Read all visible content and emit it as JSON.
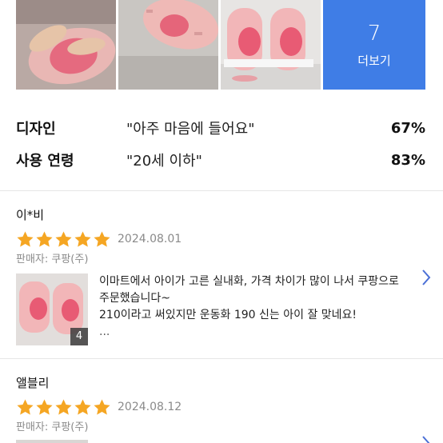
{
  "photos": {
    "more_count": "7",
    "more_label": "더보기"
  },
  "summary": [
    {
      "key": "디자인",
      "quote": "\"아주 마음에 들어요\"",
      "pct": "67%"
    },
    {
      "key": "사용 연령",
      "quote": "\"20세 이하\"",
      "pct": "83%"
    }
  ],
  "reviews": [
    {
      "name": "이*비",
      "stars": 5,
      "date": "2024.08.01",
      "seller": "판매자: 쿠팡(주)",
      "photo_count": "4",
      "line1": "이마트에서 아이가 고른 실내화, 가격 차이가 많이 나서 쿠팡으로",
      "line2": "주문했습니다~",
      "line3": "210이라고 써있지만 운동화 190 신는 아이 잘 맞네요!",
      "more": "..."
    },
    {
      "name": "앨블리",
      "stars": 5,
      "date": "2024.08.12",
      "seller": "판매자: 쿠팡(주)"
    }
  ],
  "colors": {
    "accent": "#3f7de6",
    "star": "#f5a623",
    "sandal_pink": "#f2b6b8"
  },
  "icons": {
    "chevron": "chevron-right-icon",
    "star": "star-icon"
  }
}
